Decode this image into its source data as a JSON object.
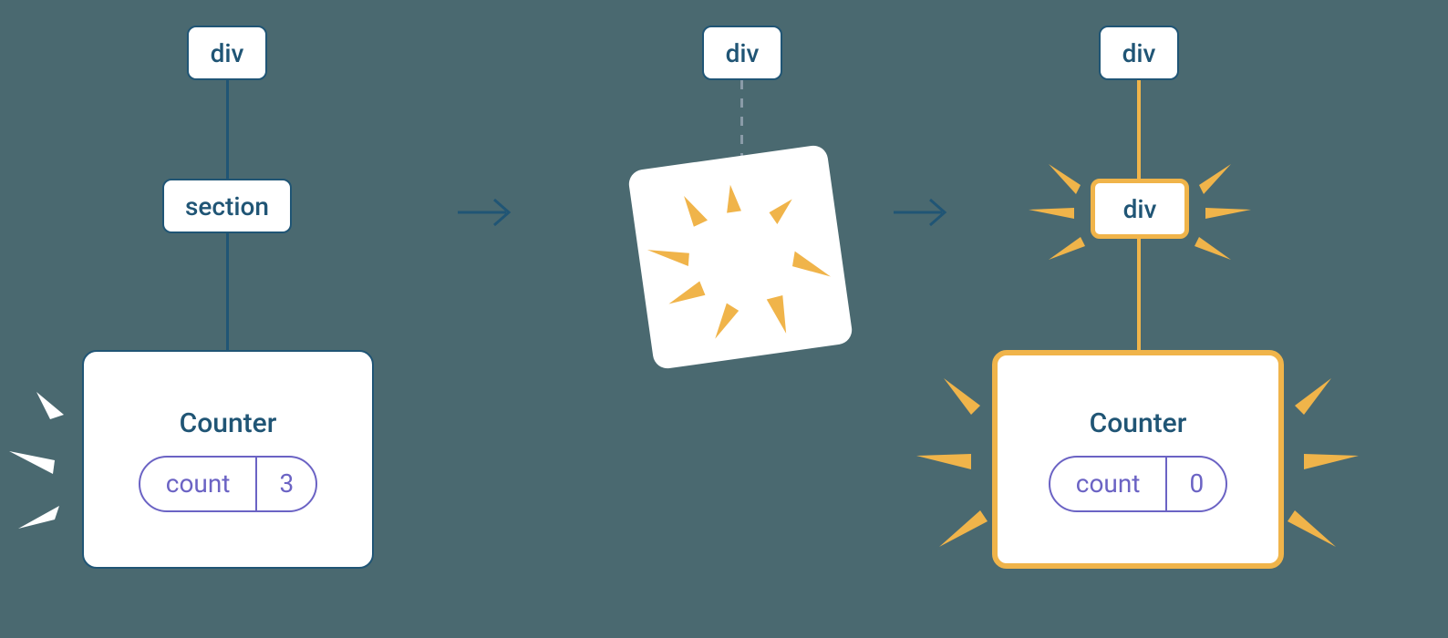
{
  "tree1": {
    "root": "div",
    "mid": "section",
    "counter": {
      "title": "Counter",
      "label": "count",
      "value": "3"
    }
  },
  "tree2": {
    "root": "div"
  },
  "tree3": {
    "root": "div",
    "mid": "div",
    "counter": {
      "title": "Counter",
      "label": "count",
      "value": "0"
    }
  },
  "colors": {
    "blue": "#205575",
    "orange": "#f0b44a",
    "purple": "#6b63c4",
    "bg": "#4a6970",
    "white": "#ffffff"
  }
}
